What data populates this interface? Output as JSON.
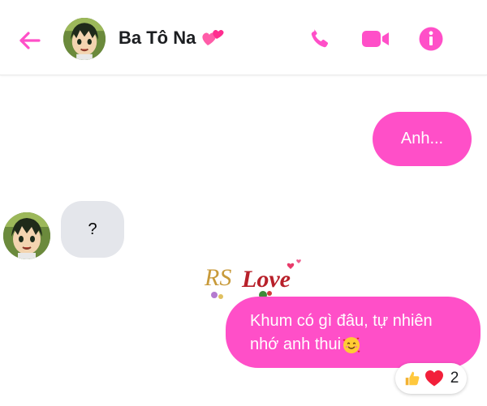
{
  "header": {
    "contact_name": "Ba Tô Na",
    "name_emoji_icon": "two-hearts-icon",
    "back_icon": "arrow-left-icon",
    "call_icon": "phone-icon",
    "video_icon": "video-camera-icon",
    "info_icon": "info-icon"
  },
  "messages": [
    {
      "direction": "outgoing",
      "text": "Anh..."
    },
    {
      "direction": "incoming",
      "text": "?"
    },
    {
      "direction": "outgoing",
      "text_line1": "Khum có gì đâu, tự nhiên",
      "text_line2": "nhớ anh thui",
      "emoji_icon": "smiling-face-with-hearts-icon"
    }
  ],
  "sticker": {
    "text": "Love",
    "initials": "RS"
  },
  "reactions": {
    "icons": [
      "thumbs-up-icon",
      "heart-icon"
    ],
    "count": "2"
  },
  "colors": {
    "accent": "#ff4fc8",
    "incoming_bubble": "#e4e6eb",
    "header_icons": "#ff4fc8"
  }
}
